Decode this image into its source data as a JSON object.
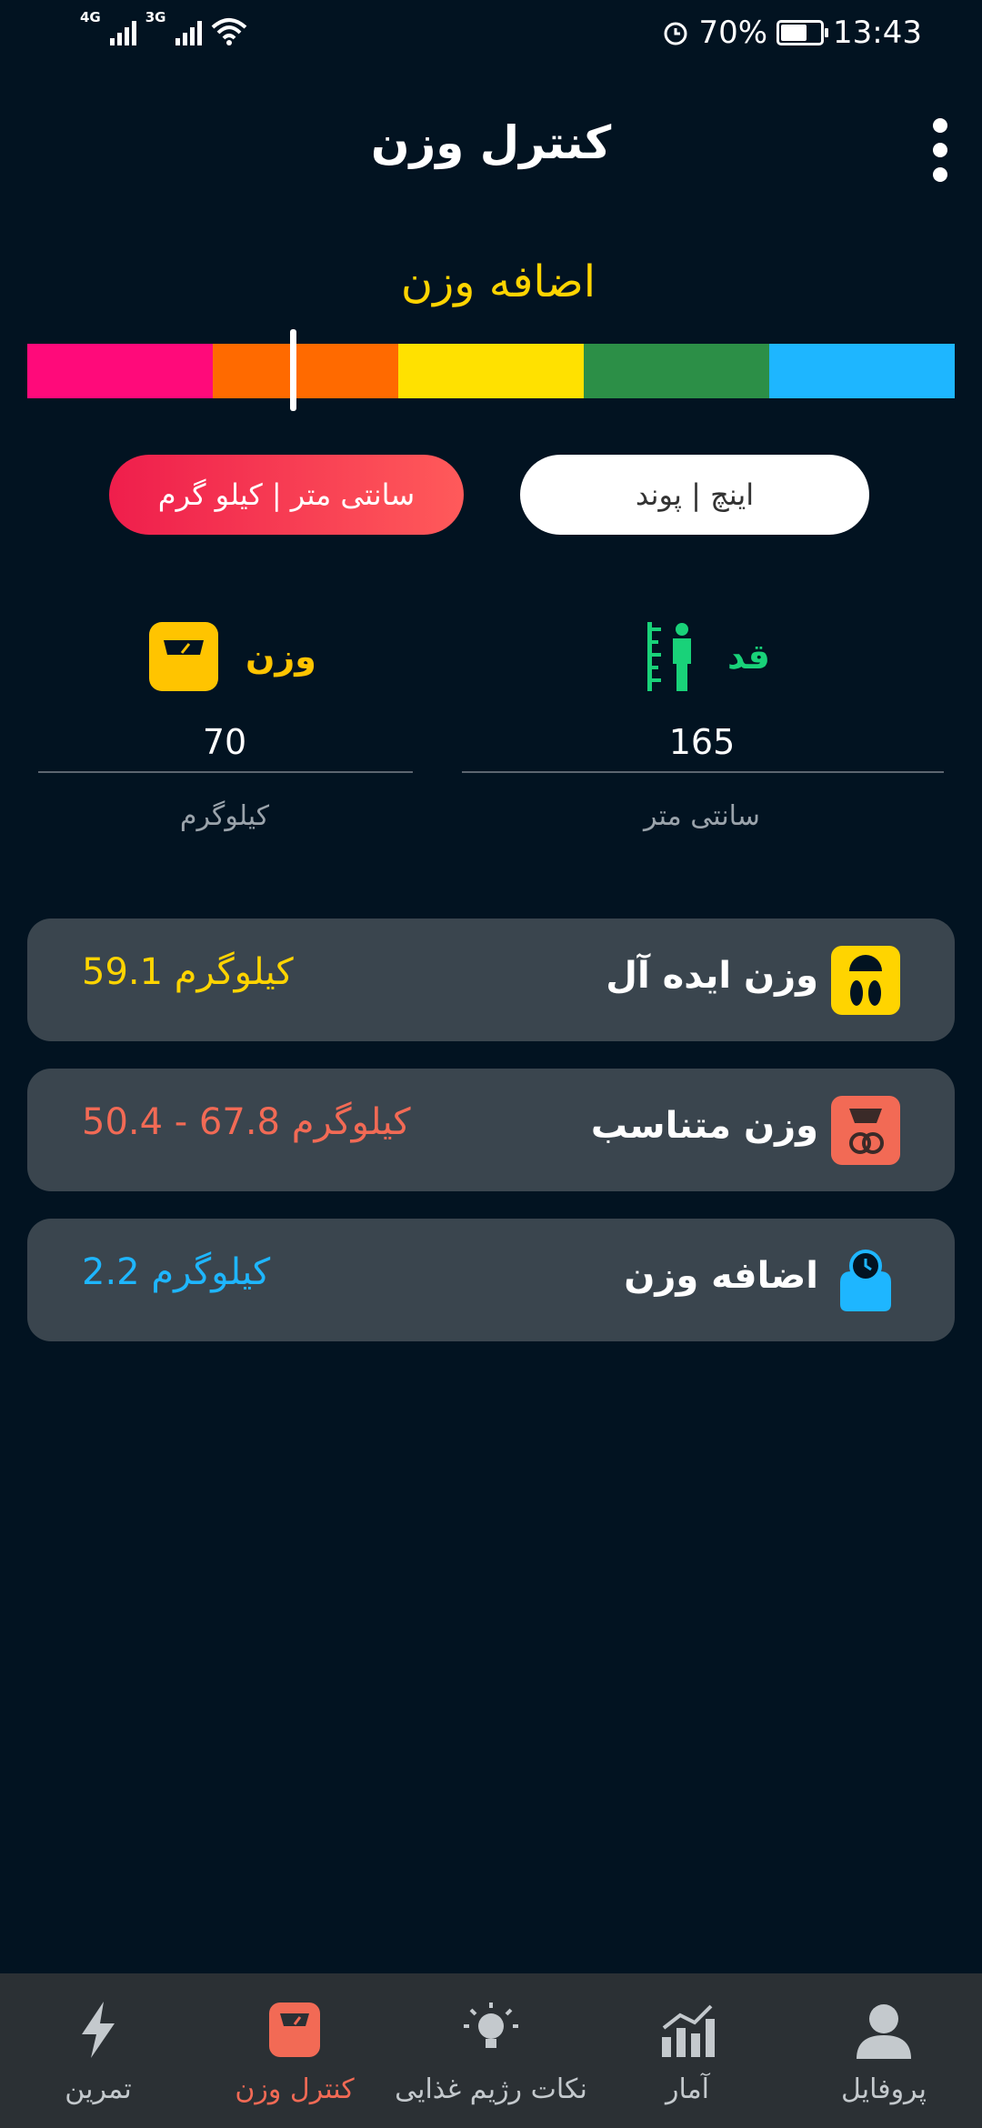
{
  "status_bar": {
    "net1": "4G",
    "net2": "3G",
    "battery_pct": "70%",
    "battery_level": 0.7,
    "time": "13:43"
  },
  "header": {
    "title": "کنترل وزن"
  },
  "bmi": {
    "status": "اضافه وزن",
    "status_color": "#FFD400",
    "scale_colors": [
      "#FF0A7A",
      "#FF6A00",
      "#FFE100",
      "#2C8F47",
      "#1EB6FF"
    ],
    "marker_fraction": 0.286
  },
  "units": {
    "metric_label": "سانتی متر | کیلو گرم",
    "imperial_label": "اینچ | پوند",
    "selected": "metric"
  },
  "inputs": {
    "height_label": "قد",
    "height_value": "165",
    "height_unit": "سانتی متر",
    "weight_label": "وزن",
    "weight_value": "70",
    "weight_unit": "کیلوگرم"
  },
  "results": [
    {
      "name": "وزن ایده آل",
      "value": "59.1 کیلوگرم",
      "color": "#FFD400",
      "icon": "feet-scale-icon"
    },
    {
      "name": "وزن متناسب",
      "value": "50.4 - 67.8 کیلوگرم",
      "color": "#F26A55",
      "icon": "scale-apple-icon"
    },
    {
      "name": "اضافه وزن",
      "value": "2.2 کیلوگرم",
      "color": "#1EB6FF",
      "icon": "body-clock-icon"
    }
  ],
  "nav": [
    {
      "label": "تمرین",
      "icon": "lightning-icon"
    },
    {
      "label": "کنترل وزن",
      "icon": "scale-icon",
      "active": true
    },
    {
      "label": "نکات رژیم غذایی",
      "icon": "bulb-icon"
    },
    {
      "label": "آمار",
      "icon": "chart-icon"
    },
    {
      "label": "پروفایل",
      "icon": "person-icon"
    }
  ]
}
